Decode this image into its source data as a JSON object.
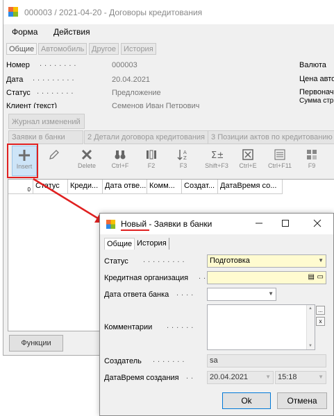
{
  "main_window": {
    "title": "000003 / 2021-04-20 - Договоры кредитования",
    "menu": [
      "Форма",
      "Действия"
    ],
    "top_tabs": [
      "Общие",
      "Автомобиль",
      "Другое",
      "История"
    ],
    "fields": {
      "number_label": "Номер",
      "number_value": "000003",
      "date_label": "Дата",
      "date_value": "20.04.2021",
      "status_label": "Статус",
      "status_value": "Предложение",
      "client_label": "Клиент (текст)",
      "client_value": "Семенов Иван Петрович",
      "currency_label": "Валюта",
      "price_label": "Цена авто",
      "first_label": "Первонач",
      "sum_label": "Сумма стр"
    },
    "journal_tab": "Журнал изменений",
    "sub_tabs": [
      "Заявки в банки",
      "Детали договора кредитования",
      "Позиции актов по кредитованию"
    ],
    "sub_tab_numbers": [
      "2",
      "3"
    ],
    "toolbar": [
      {
        "icon": "plus-icon",
        "label": "Insert"
      },
      {
        "icon": "pencil-icon",
        "label": ""
      },
      {
        "icon": "delete-x-icon",
        "label": "Delete"
      },
      {
        "icon": "binoculars-icon",
        "label": "Ctrl+F"
      },
      {
        "icon": "columns-icon",
        "label": "F2"
      },
      {
        "icon": "sort-az-icon",
        "label": "F3"
      },
      {
        "icon": "sum-icon",
        "label": "Shift+F3"
      },
      {
        "icon": "excel-icon",
        "label": "Ctrl+E"
      },
      {
        "icon": "list-icon",
        "label": "Ctrl+F11"
      },
      {
        "icon": "tiles-icon",
        "label": "F9"
      }
    ],
    "grid_columns": [
      "Статус",
      "Креди...",
      "Дата отве...",
      "Комм...",
      "Создат...",
      "ДатаВремя со..."
    ],
    "grid_row_indicator": "0",
    "functions_button": "Функции"
  },
  "dialog": {
    "title_new": "Новый",
    "title_sep": " - ",
    "title_rest": "Заявки в банки",
    "tabs": [
      "Общие",
      "История"
    ],
    "status_label": "Статус",
    "status_value": "Подготовка",
    "credit_org_label": "Кредитная организация",
    "credit_org_value": "",
    "bank_answer_date_label": "Дата ответа банка",
    "bank_answer_date_value": "",
    "comments_label": "Комментарии",
    "comments_value": "",
    "creator_label": "Создатель",
    "creator_value": "sa",
    "created_label": "ДатаВремя создания",
    "created_date": "20.04.2021",
    "created_time": "15:18",
    "ellipsis_button": "...",
    "clear_button": "x",
    "ok_button": "Ok",
    "cancel_button": "Отмена"
  },
  "colors": {
    "annotation_red": "#e02020",
    "required_yellow": "#fffbd0",
    "toolbar_highlight": "#cde4f7"
  }
}
